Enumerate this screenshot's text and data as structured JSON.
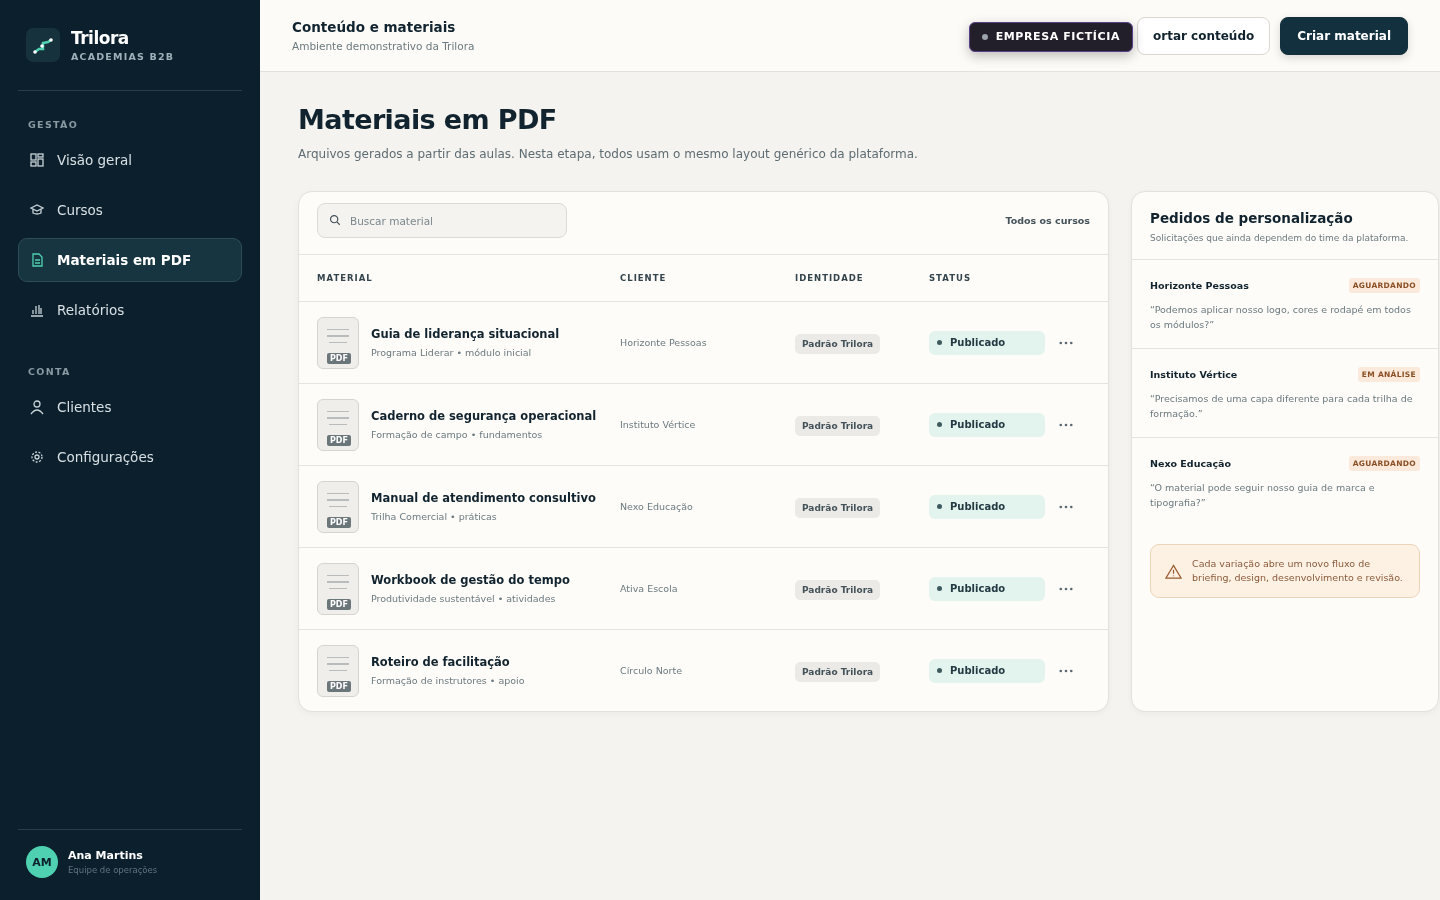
{
  "brand": {
    "name": "Trilora",
    "tagline": "ACADEMIAS B2B"
  },
  "sidebar": {
    "sections": [
      {
        "title": "GESTÃO",
        "items": [
          {
            "label": "Visão geral",
            "kind": "grid",
            "selected": false
          },
          {
            "label": "Cursos",
            "kind": "cap",
            "selected": false
          },
          {
            "label": "Materiais em PDF",
            "kind": "doc",
            "selected": true
          },
          {
            "label": "Relatórios",
            "kind": "chart",
            "selected": false
          }
        ]
      },
      {
        "title": "CONTA",
        "items": [
          {
            "label": "Clientes",
            "kind": "user",
            "selected": false
          },
          {
            "label": "Configurações",
            "kind": "gear",
            "selected": false
          }
        ]
      }
    ]
  },
  "user": {
    "initials": "AM",
    "name": "Ana Martins",
    "role": "Equipe de operações"
  },
  "header": {
    "title": "Conteúdo e materiais",
    "subtitle": "Ambiente demonstrativo da Trilora",
    "badge": "EMPRESA FICTÍCIA",
    "export_button": "ortar conteúdo",
    "create_button": "Criar material"
  },
  "page": {
    "title": "Materiais em PDF",
    "description": "Arquivos gerados a partir das aulas. Nesta etapa, todos usam o mesmo layout genérico da plataforma."
  },
  "table": {
    "search": {
      "placeholder": "Buscar material"
    },
    "filter": "Todos os cursos",
    "columns": [
      "MATERIAL",
      "CLIENTE",
      "IDENTIDADE",
      "STATUS"
    ],
    "rows": [
      {
        "file_tag": "PDF",
        "title": "Guia de liderança situacional",
        "subtitle": "Programa Liderar • módulo inicial",
        "client": "Horizonte Pessoas",
        "identity": "Padrão Trilora",
        "status": "Publicado"
      },
      {
        "file_tag": "PDF",
        "title": "Caderno de segurança operacional",
        "subtitle": "Formação de campo • fundamentos",
        "client": "Instituto Vértice",
        "identity": "Padrão Trilora",
        "status": "Publicado"
      },
      {
        "file_tag": "PDF",
        "title": "Manual de atendimento consultivo",
        "subtitle": "Trilha Comercial • práticas",
        "client": "Nexo Educação",
        "identity": "Padrão Trilora",
        "status": "Publicado"
      },
      {
        "file_tag": "PDF",
        "title": "Workbook de gestão do tempo",
        "subtitle": "Produtividade sustentável • atividades",
        "client": "Ativa Escola",
        "identity": "Padrão Trilora",
        "status": "Publicado"
      },
      {
        "file_tag": "PDF",
        "title": "Roteiro de facilitação",
        "subtitle": "Formação de instrutores • apoio",
        "client": "Círculo Norte",
        "identity": "Padrão Trilora",
        "status": "Publicado"
      }
    ]
  },
  "requests": {
    "title": "Pedidos de personalização",
    "subtitle": "Solicitações que ainda dependem do time da plataforma.",
    "items": [
      {
        "client": "Horizonte Pessoas",
        "status": "AGUARDANDO",
        "quote": "“Podemos aplicar nosso logo, cores e rodapé em todos os módulos?”"
      },
      {
        "client": "Instituto Vértice",
        "status": "EM ANÁLISE",
        "quote": "“Precisamos de uma capa diferente para cada trilha de formação.”"
      },
      {
        "client": "Nexo Educação",
        "status": "AGUARDANDO",
        "quote": "“O material pode seguir nosso guia de marca e tipografia?”"
      }
    ],
    "warning": "Cada variação abre um novo fluxo de briefing, design, desenvolvimento e revisão."
  }
}
